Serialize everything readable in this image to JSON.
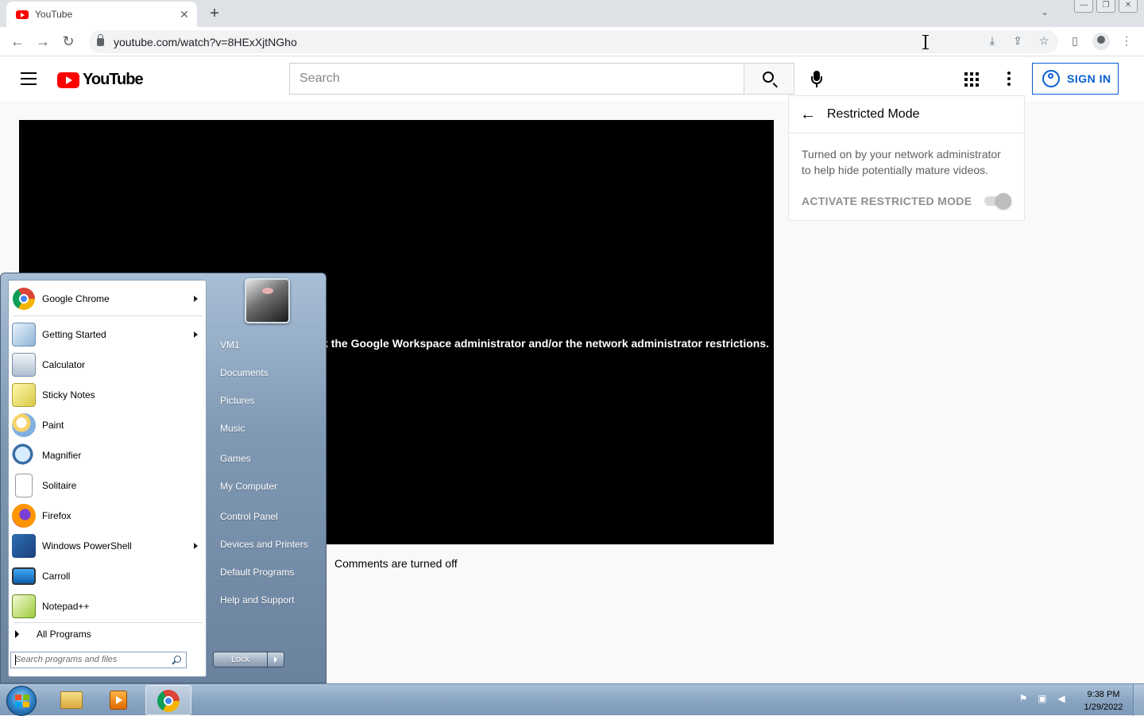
{
  "browser": {
    "tab_title": "YouTube",
    "tab_close": "✕",
    "new_tab": "+",
    "tab_search": "⌄",
    "url": "youtube.com/watch?v=8HExXjtNGho",
    "window_controls": [
      "—",
      "❐",
      "✕"
    ],
    "nav": {
      "back": "←",
      "forward": "→",
      "reload": "↻"
    },
    "toolbar_icons": {
      "install": "⤓",
      "share": "⇪",
      "bookmark": "☆",
      "sidepanel": "▯",
      "menu": "⋮"
    }
  },
  "youtube": {
    "logo_text": "YouTube",
    "search_placeholder": "Search",
    "sign_in": "SIGN IN",
    "player_message": "eck the Google Workspace administrator and/or the network administrator restrictions.",
    "comments_status": "Comments are turned off",
    "restricted_mode": {
      "title": "Restricted Mode",
      "back": "←",
      "description": "Turned on by your network administrator to help hide potentially mature videos.",
      "toggle_label": "ACTIVATE RESTRICTED MODE",
      "toggle_state": "on-disabled"
    }
  },
  "start_menu": {
    "programs": [
      {
        "label": "Google Chrome",
        "icon": "chrome-icon",
        "submenu": true
      },
      {
        "label": "Getting Started",
        "icon": "getting-started-icon",
        "submenu": true
      },
      {
        "label": "Calculator",
        "icon": "calculator-icon",
        "submenu": false
      },
      {
        "label": "Sticky Notes",
        "icon": "sticky-notes-icon",
        "submenu": false
      },
      {
        "label": "Paint",
        "icon": "paint-icon",
        "submenu": false
      },
      {
        "label": "Magnifier",
        "icon": "magnifier-icon",
        "submenu": false
      },
      {
        "label": "Solitaire",
        "icon": "solitaire-icon",
        "submenu": false
      },
      {
        "label": "Firefox",
        "icon": "firefox-icon",
        "submenu": false
      },
      {
        "label": "Windows PowerShell",
        "icon": "powershell-icon",
        "submenu": true
      },
      {
        "label": "Carroll",
        "icon": "monitor-icon",
        "submenu": false
      },
      {
        "label": "Notepad++",
        "icon": "notepadpp-icon",
        "submenu": false
      }
    ],
    "all_programs": "All Programs",
    "search_placeholder": "Search programs and files",
    "right_items": [
      "VM1",
      "Documents",
      "Pictures",
      "Music",
      "Games",
      "My Computer",
      "Control Panel",
      "Devices and Printers",
      "Default Programs",
      "Help and Support"
    ],
    "lock_button": "Lock"
  },
  "taskbar": {
    "time": "9:38 PM",
    "date": "1/29/2022",
    "tray_icons": [
      "action-center-icon",
      "network-icon",
      "volume-icon"
    ]
  },
  "colors": {
    "youtube_red": "#ff0000",
    "sign_in_blue": "#065fd4",
    "taskbar": "#8aa6c3"
  }
}
